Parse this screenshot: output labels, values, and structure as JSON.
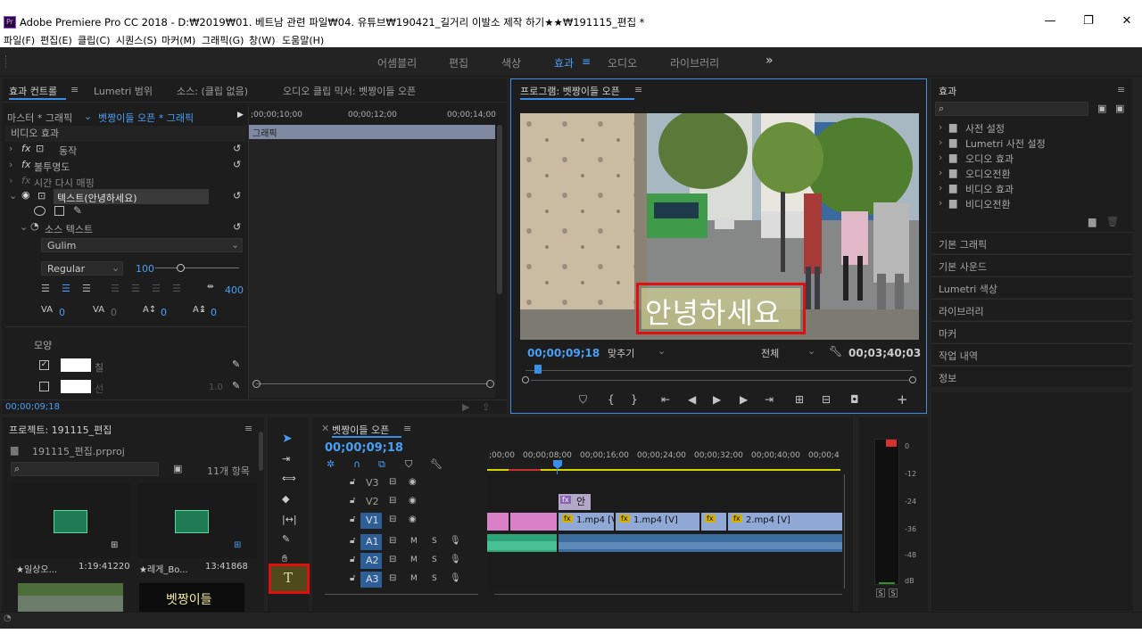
{
  "window": {
    "title": "Adobe Premiere Pro CC 2018 - D:₩2019₩01. 베트남 관련 파일₩04. 유튜브₩190421_길거리 이발소 제작 하기★★₩191115_편집 *",
    "app_icon": "Pr",
    "controls": [
      "—",
      "❐",
      "✕"
    ]
  },
  "menu": [
    "파일(F)",
    "편집(E)",
    "클립(C)",
    "시퀀스(S)",
    "마커(M)",
    "그래픽(G)",
    "창(W)",
    "도움말(H)"
  ],
  "workspaces": {
    "items": [
      "어셈블리",
      "편집",
      "색상",
      "효과",
      "오디오",
      "라이브러리"
    ],
    "active": "효과",
    "more": "»"
  },
  "effect_controls": {
    "tabs": [
      "효과 컨트롤",
      "Lumetri 범위",
      "소스: (클립 없음)",
      "오디오 클립 믹서: 벳짱이들 오픈"
    ],
    "master": "마스터 * 그래픽",
    "sequence": "벳짱이들 오픈 * 그래픽",
    "section": "비디오 효과",
    "effects": [
      "동작",
      "불투명도",
      "시간 다시 매핑",
      "텍스트(안녕하세요)"
    ],
    "source_text": "소스 텍스트",
    "font": "Gulim",
    "font_style": "Regular",
    "font_size": "100",
    "tracking": "400",
    "kerning": "0",
    "tsume": "0",
    "baseline": "0",
    "leading": "0",
    "appearance": "모양",
    "fill_label": "칠",
    "stroke_label": "선",
    "stroke_width": "1.0",
    "timecode": "00;00;09;18",
    "ruler": [
      ";00;00;10;00",
      "00;00;12;00",
      "00;00;14;00"
    ],
    "clip_label": "그래픽"
  },
  "program": {
    "title": "프로그램: 벳짱이들 오픈",
    "overlay_text": "안녕하세요",
    "timecode": "00;00;09;18",
    "fit": "맞추기",
    "quality": "전체",
    "duration": "00;03;40;03"
  },
  "effects_panel": {
    "title": "효과",
    "folders": [
      "사전 설정",
      "Lumetri 사전 설정",
      "오디오 효과",
      "오디오전환",
      "비디오 효과",
      "비디오전환"
    ],
    "sections": [
      "기본 그래픽",
      "기본 사운드",
      "Lumetri 색상",
      "라이브러리",
      "마커",
      "작업 내역",
      "정보"
    ]
  },
  "project": {
    "title": "프로젝트: 191115_편집",
    "file": "191115_편집.prproj",
    "count": "11개 항목",
    "items": [
      {
        "name": "★일상오...",
        "duration": "1:19:41220"
      },
      {
        "name": "★레게_Bo...",
        "duration": "13:41868"
      }
    ],
    "thumb_text": "벳짱이들"
  },
  "timeline": {
    "title": "벳짱이들 오픈",
    "timecode": "00;00;09;18",
    "ruler": [
      ";00;00",
      "00;00;08;00",
      "00;00;16;00",
      "00;00;24;00",
      "00;00;32;00",
      "00;00;40;00",
      "00;00;4"
    ],
    "video_tracks": [
      "V3",
      "V2",
      "V1"
    ],
    "audio_tracks": [
      "A1",
      "A2",
      "A3"
    ],
    "graphic_clip": "안",
    "clips": [
      "1.mp4 [V]",
      "1.mp4 [V]",
      "2.mp4 [V]"
    ],
    "mute_solo": [
      "M",
      "S"
    ]
  },
  "meter": {
    "labels": [
      "0",
      "-12",
      "-24",
      "-36",
      "-48",
      "dB"
    ],
    "solo": [
      "S",
      "S"
    ]
  }
}
